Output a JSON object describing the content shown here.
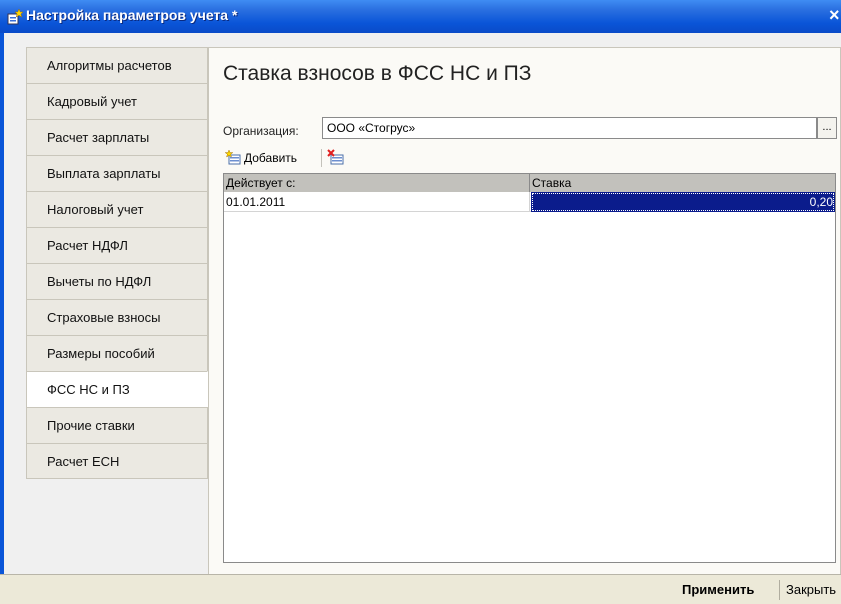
{
  "window": {
    "title": "Настройка параметров учета *",
    "close_glyph": "×"
  },
  "tabs": [
    {
      "label": "Алгоритмы расчетов"
    },
    {
      "label": "Кадровый учет"
    },
    {
      "label": "Расчет зарплаты"
    },
    {
      "label": "Выплата зарплаты"
    },
    {
      "label": "Налоговый учет"
    },
    {
      "label": "Расчет НДФЛ"
    },
    {
      "label": "Вычеты по НДФЛ"
    },
    {
      "label": "Страховые взносы"
    },
    {
      "label": "Размеры пособий"
    },
    {
      "label": "ФСС НС и ПЗ",
      "active": true
    },
    {
      "label": "Прочие ставки"
    },
    {
      "label": "Расчет ЕСН"
    }
  ],
  "panel": {
    "title": "Ставка взносов в ФСС НС и ПЗ",
    "org_label": "Организация:",
    "org_value": "ООО «Стогрус»",
    "org_button": "...",
    "add_label": "Добавить",
    "columns": [
      "Действует с:",
      "Ставка"
    ],
    "rows": [
      {
        "date": "01.01.2011",
        "rate": "0,20"
      }
    ]
  },
  "footer": {
    "apply_label": "Применить",
    "close_label": "Закрыть"
  },
  "colors": {
    "titlebar": "#0a55d8",
    "selection": "#0b1c8c"
  }
}
